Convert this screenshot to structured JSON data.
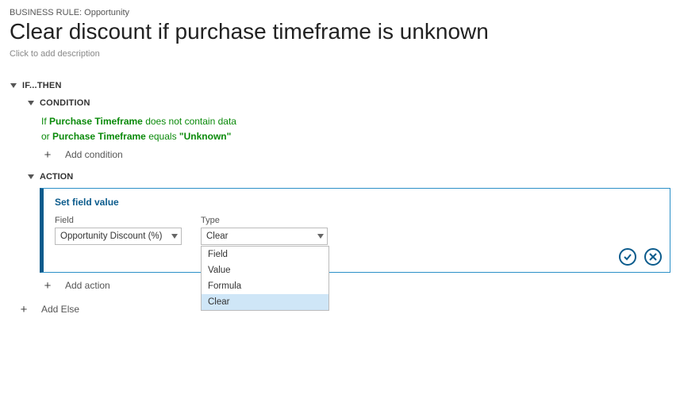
{
  "breadcrumb": "BUSINESS RULE: Opportunity",
  "title": "Clear discount if purchase timeframe is unknown",
  "desc_placeholder": "Click to add description",
  "ifthen_label": "IF...THEN",
  "condition_label": "CONDITION",
  "conditions": [
    {
      "prefix": "If",
      "field": "Purchase Timeframe",
      "operator": "does not contain data",
      "value": ""
    },
    {
      "prefix": "or",
      "field": "Purchase Timeframe",
      "operator": "equals",
      "value": "\"Unknown\""
    }
  ],
  "add_condition_label": "Add condition",
  "action_label": "ACTION",
  "action_card": {
    "title": "Set field value",
    "field_label": "Field",
    "field_value": "Opportunity Discount (%)",
    "type_label": "Type",
    "type_value": "Clear"
  },
  "type_options": [
    "Field",
    "Value",
    "Formula",
    "Clear"
  ],
  "add_action_label": "Add action",
  "add_else_label": "Add Else"
}
